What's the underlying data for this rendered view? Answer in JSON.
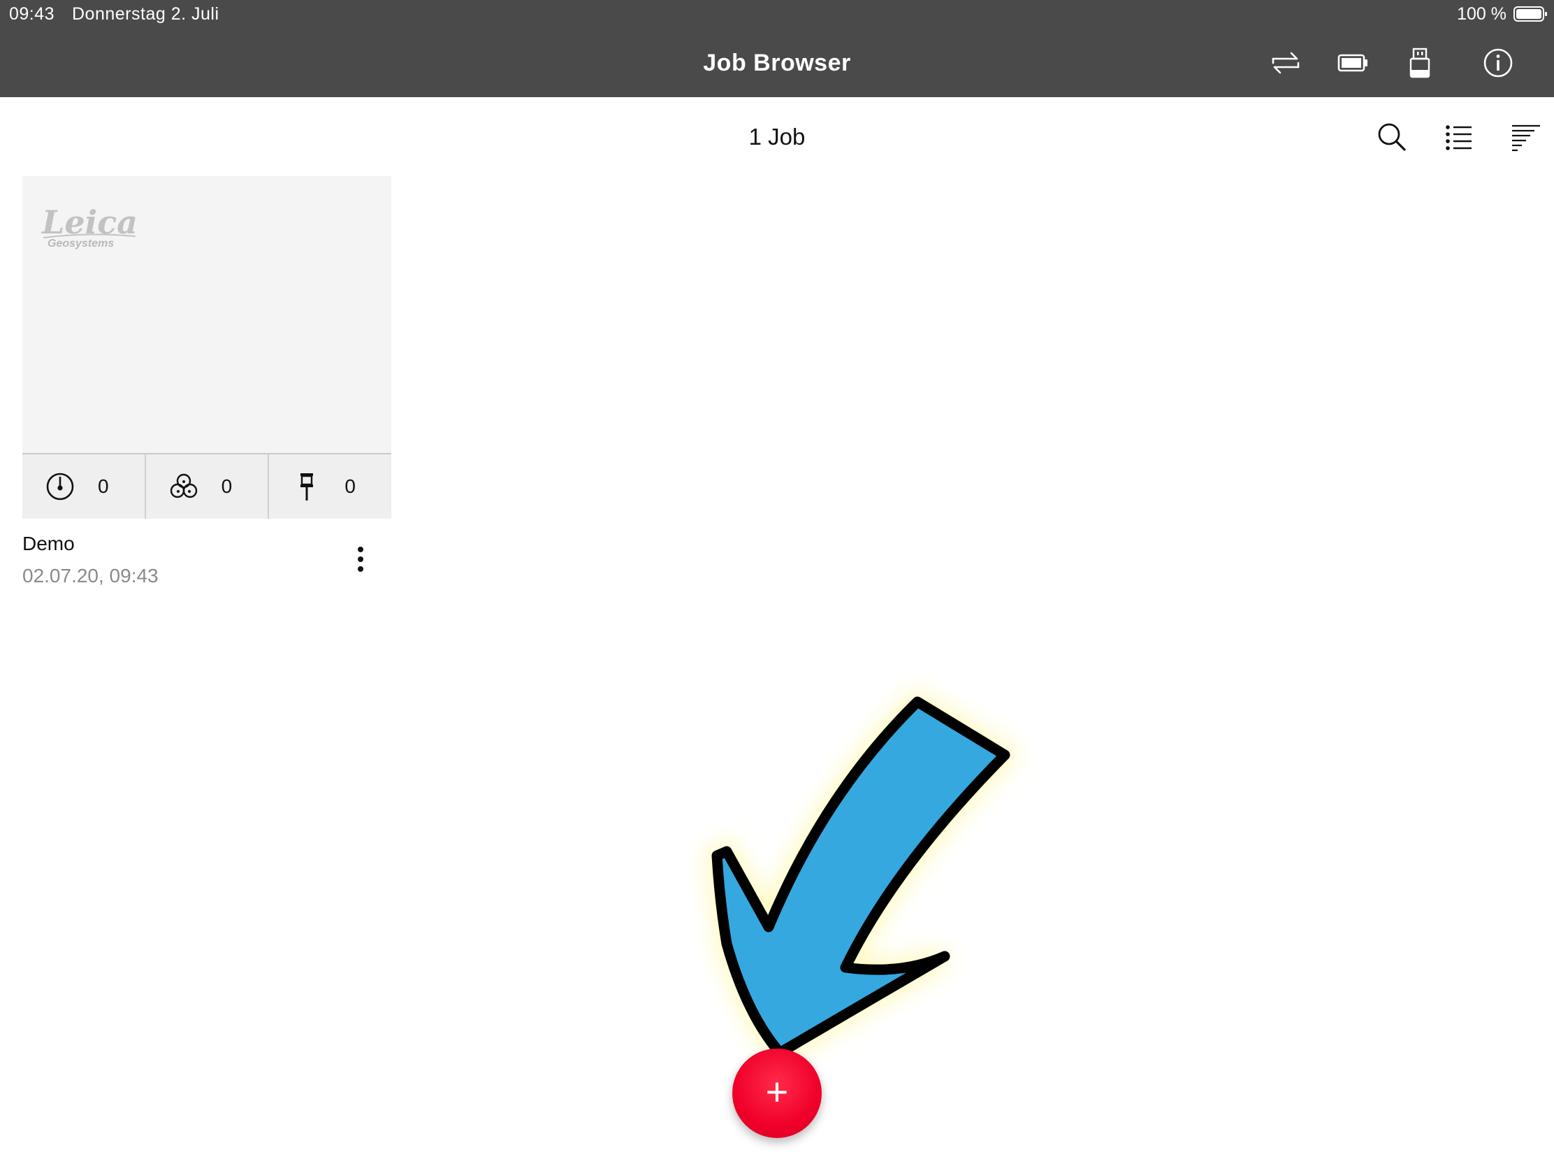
{
  "status_bar": {
    "time": "09:43",
    "date": "Donnerstag 2. Juli",
    "battery": "100 %"
  },
  "header": {
    "title": "Job Browser",
    "icons": [
      "transfer-icon",
      "battery-icon",
      "usb-icon",
      "info-icon"
    ]
  },
  "subheader": {
    "job_count": "1 Job",
    "icons": [
      "search-icon",
      "list-view-icon",
      "sort-icon"
    ]
  },
  "jobs": [
    {
      "name": "Demo",
      "date": "02.07.20, 09:43",
      "logo_text": "Leica",
      "logo_subtext": "Geosystems",
      "stats": [
        {
          "icon": "station-setup-icon",
          "value": "0"
        },
        {
          "icon": "scans-icon",
          "value": "0"
        },
        {
          "icon": "target-pole-icon",
          "value": "0"
        }
      ]
    }
  ],
  "fab": {
    "label": "+",
    "icon": "add-icon",
    "color": "#f0002a"
  },
  "annotation": {
    "icon": "arrow-pointer-icon",
    "color": "#35a8e0"
  },
  "colors": {
    "topbar": "#4a4a4a",
    "card_thumb": "#f4f4f4",
    "card_stats": "#efefef"
  }
}
